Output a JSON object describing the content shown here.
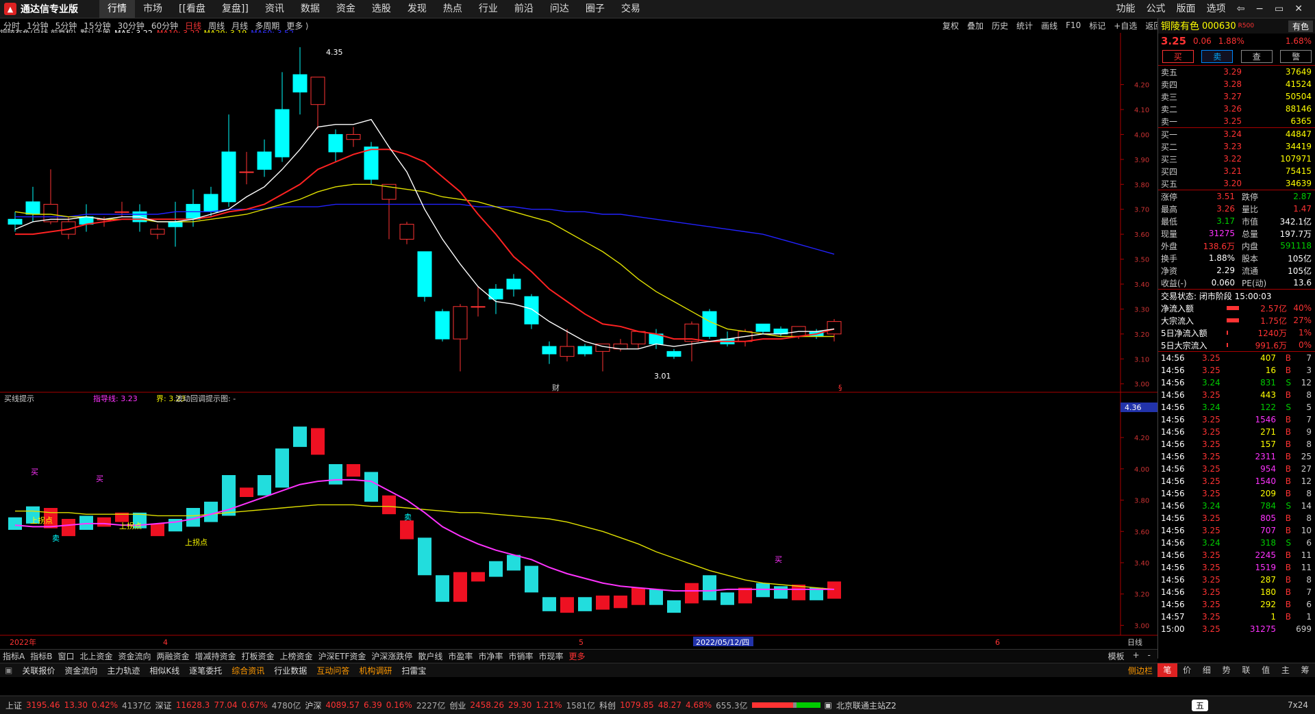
{
  "app": {
    "title": "通达信专业版",
    "menu": [
      "行情",
      "市场",
      "[[看盘",
      "复盘]]",
      "资讯",
      "数据",
      "资金",
      "选股",
      "发现",
      "热点",
      "行业",
      "前沿",
      "问达",
      "圈子",
      "交易"
    ],
    "right_menu": [
      "功能",
      "公式",
      "版面",
      "选项"
    ]
  },
  "periods": [
    "分时",
    "1分钟",
    "5分钟",
    "15分钟",
    "30分钟",
    "60分钟",
    "日线",
    "周线",
    "月线",
    "多周期",
    "更多 ⟩"
  ],
  "toolbar2": [
    "复权",
    "叠加",
    "历史",
    "统计",
    "画线",
    "F10",
    "标记",
    "+自选",
    "返回"
  ],
  "main_header": {
    "stock": "铜陵有色(日线,前复权)",
    "template": "默认主图",
    "ma5": "MA5: 3.22",
    "ma10": "MA10: 3.22",
    "ma20": "MA20: 3.19",
    "ma60": "MA60: 3.52"
  },
  "sub_header": {
    "name": "买线提示",
    "guide": "指导线: 3.23",
    "jie": "界: 3.23",
    "wave": "波动回调提示图: -"
  },
  "annotations": {
    "high": "4.35",
    "low": "3.01",
    "cai": "财",
    "s1": "§",
    "buy1": "买",
    "buy2": "买",
    "buy3": "买",
    "sell1": "卖",
    "sell2": "卖",
    "up1": "上拐点",
    "up2": "上拐点",
    "up3": "上拐点"
  },
  "axis_main": [
    "4.20",
    "4.10",
    "4.00",
    "3.90",
    "3.80",
    "3.70",
    "3.60",
    "3.50",
    "3.40",
    "3.30",
    "3.20",
    "3.10",
    "3.00"
  ],
  "axis_sub": [
    "4.20",
    "4.00",
    "3.80",
    "3.60",
    "3.40",
    "3.20",
    "3.00"
  ],
  "axis_sub_top": "4.36",
  "date_axis": {
    "start": "2022年",
    "m4": "4",
    "m5": "5",
    "cursor": "2022/05/12/四",
    "m6": "6",
    "period": "日线"
  },
  "chart_data": {
    "type": "candlestick",
    "title": "铜陵有色(日线,前复权)",
    "ylim": [
      2.98,
      4.38
    ],
    "candles": [
      [
        3.66,
        3.64,
        3.69,
        3.61
      ],
      [
        3.73,
        3.68,
        3.79,
        3.65
      ],
      [
        3.65,
        3.72,
        3.86,
        3.64
      ],
      [
        3.6,
        3.65,
        3.67,
        3.58
      ],
      [
        3.67,
        3.64,
        3.72,
        3.61
      ],
      [
        3.66,
        3.66,
        3.67,
        3.63
      ],
      [
        3.69,
        3.69,
        3.73,
        3.67
      ],
      [
        3.69,
        3.65,
        3.72,
        3.61
      ],
      [
        3.6,
        3.62,
        3.64,
        3.58
      ],
      [
        3.65,
        3.63,
        3.73,
        3.55
      ],
      [
        3.72,
        3.66,
        3.78,
        3.63
      ],
      [
        3.76,
        3.69,
        3.79,
        3.67
      ],
      [
        3.93,
        3.73,
        4.08,
        3.71
      ],
      [
        3.85,
        3.85,
        3.93,
        3.8
      ],
      [
        3.93,
        3.86,
        3.98,
        3.83
      ],
      [
        4.1,
        3.91,
        4.25,
        3.89
      ],
      [
        4.24,
        4.17,
        4.35,
        4.08
      ],
      [
        4.12,
        4.23,
        4.2,
        4.02
      ],
      [
        4.0,
        3.93,
        4.02,
        3.89
      ],
      [
        3.98,
        4.0,
        4.03,
        3.95
      ],
      [
        3.95,
        3.82,
        3.97,
        3.8
      ],
      [
        3.74,
        3.8,
        3.75,
        3.58
      ],
      [
        3.58,
        3.64,
        3.65,
        3.56
      ],
      [
        3.53,
        3.35,
        3.53,
        3.33
      ],
      [
        3.29,
        3.18,
        3.3,
        3.17
      ],
      [
        3.18,
        3.31,
        3.32,
        3.05
      ],
      [
        3.31,
        3.31,
        3.39,
        3.27
      ],
      [
        3.38,
        3.34,
        3.4,
        3.28
      ],
      [
        3.42,
        3.38,
        3.44,
        3.35
      ],
      [
        3.35,
        3.24,
        3.36,
        3.22
      ],
      [
        3.15,
        3.12,
        3.17,
        3.08
      ],
      [
        3.11,
        3.15,
        3.22,
        3.09
      ],
      [
        3.15,
        3.12,
        3.16,
        3.11
      ],
      [
        3.13,
        3.16,
        3.16,
        3.05
      ],
      [
        3.14,
        3.16,
        3.18,
        3.13
      ],
      [
        3.16,
        3.21,
        3.21,
        3.14
      ],
      [
        3.2,
        3.16,
        3.22,
        3.14
      ],
      [
        3.13,
        3.11,
        3.14,
        3.1
      ],
      [
        3.17,
        3.24,
        3.25,
        3.09
      ],
      [
        3.29,
        3.19,
        3.3,
        3.18
      ],
      [
        3.18,
        3.16,
        3.21,
        3.15
      ],
      [
        3.17,
        3.21,
        3.22,
        3.15
      ],
      [
        3.24,
        3.21,
        3.24,
        3.2
      ],
      [
        3.22,
        3.2,
        3.23,
        3.19
      ],
      [
        3.19,
        3.23,
        3.23,
        3.18
      ],
      [
        3.21,
        3.19,
        3.22,
        3.18
      ],
      [
        3.2,
        3.25,
        3.26,
        3.17
      ]
    ],
    "ma5": [
      3.62,
      3.65,
      3.66,
      3.66,
      3.67,
      3.66,
      3.67,
      3.67,
      3.65,
      3.65,
      3.66,
      3.68,
      3.7,
      3.75,
      3.79,
      3.86,
      3.94,
      4.03,
      4.04,
      4.04,
      4.06,
      3.95,
      3.85,
      3.7,
      3.58,
      3.48,
      3.39,
      3.33,
      3.32,
      3.3,
      3.25,
      3.21,
      3.17,
      3.15,
      3.14,
      3.14,
      3.16,
      3.15,
      3.16,
      3.17,
      3.18,
      3.19,
      3.2,
      3.2,
      3.21,
      3.21,
      3.22
    ],
    "ma10": [
      3.6,
      3.6,
      3.61,
      3.62,
      3.64,
      3.65,
      3.66,
      3.66,
      3.66,
      3.66,
      3.66,
      3.67,
      3.69,
      3.7,
      3.72,
      3.76,
      3.8,
      3.86,
      3.89,
      3.92,
      3.94,
      3.94,
      3.92,
      3.89,
      3.83,
      3.77,
      3.68,
      3.6,
      3.51,
      3.45,
      3.38,
      3.33,
      3.28,
      3.24,
      3.23,
      3.21,
      3.2,
      3.18,
      3.18,
      3.17,
      3.17,
      3.17,
      3.18,
      3.18,
      3.19,
      3.2,
      3.22
    ],
    "ma20": [
      3.69,
      3.68,
      3.68,
      3.67,
      3.67,
      3.66,
      3.66,
      3.66,
      3.65,
      3.65,
      3.65,
      3.66,
      3.67,
      3.68,
      3.7,
      3.72,
      3.74,
      3.77,
      3.79,
      3.8,
      3.8,
      3.79,
      3.78,
      3.77,
      3.75,
      3.74,
      3.73,
      3.71,
      3.69,
      3.67,
      3.65,
      3.61,
      3.57,
      3.53,
      3.48,
      3.42,
      3.37,
      3.33,
      3.29,
      3.25,
      3.22,
      3.21,
      3.2,
      3.19,
      3.19,
      3.19,
      3.19
    ],
    "ma60": [
      3.67,
      3.67,
      3.67,
      3.67,
      3.68,
      3.68,
      3.68,
      3.68,
      3.68,
      3.69,
      3.69,
      3.69,
      3.7,
      3.7,
      3.7,
      3.71,
      3.71,
      3.71,
      3.72,
      3.72,
      3.72,
      3.72,
      3.72,
      3.72,
      3.72,
      3.72,
      3.71,
      3.71,
      3.71,
      3.7,
      3.7,
      3.69,
      3.69,
      3.68,
      3.68,
      3.67,
      3.66,
      3.65,
      3.64,
      3.63,
      3.62,
      3.61,
      3.6,
      3.58,
      3.56,
      3.54,
      3.52
    ],
    "guide_line": [
      3.64,
      3.63,
      3.63,
      3.64,
      3.65,
      3.65,
      3.64,
      3.64,
      3.65,
      3.66,
      3.68,
      3.71,
      3.74,
      3.78,
      3.82,
      3.86,
      3.9,
      3.92,
      3.93,
      3.93,
      3.92,
      3.86,
      3.8,
      3.72,
      3.63,
      3.57,
      3.52,
      3.48,
      3.45,
      3.42,
      3.37,
      3.33,
      3.3,
      3.27,
      3.25,
      3.24,
      3.23,
      3.22,
      3.22,
      3.22,
      3.23,
      3.23,
      3.23,
      3.23,
      3.23,
      3.23,
      3.23
    ],
    "jie_line": [
      3.73,
      3.73,
      3.72,
      3.72,
      3.71,
      3.71,
      3.71,
      3.71,
      3.7,
      3.7,
      3.7,
      3.71,
      3.72,
      3.73,
      3.74,
      3.75,
      3.76,
      3.77,
      3.77,
      3.77,
      3.76,
      3.76,
      3.75,
      3.74,
      3.73,
      3.72,
      3.72,
      3.71,
      3.7,
      3.69,
      3.68,
      3.66,
      3.63,
      3.6,
      3.56,
      3.52,
      3.47,
      3.43,
      3.39,
      3.35,
      3.32,
      3.29,
      3.27,
      3.26,
      3.25,
      3.24,
      3.23
    ]
  },
  "quote": {
    "name": "铜陵有色",
    "code": "000630",
    "tag": "R500",
    "sector": "有色",
    "price": "3.25",
    "change": "0.06",
    "pct": "1.88%",
    "pct2": "1.68%",
    "btn_buy": "买",
    "btn_sell": "卖",
    "btn_query": "查",
    "btn_alert": "警",
    "asks": [
      [
        "卖五",
        "3.29",
        "37649"
      ],
      [
        "卖四",
        "3.28",
        "41524"
      ],
      [
        "卖三",
        "3.27",
        "50504"
      ],
      [
        "卖二",
        "3.26",
        "88146"
      ],
      [
        "卖一",
        "3.25",
        "6365"
      ]
    ],
    "bids": [
      [
        "买一",
        "3.24",
        "44847"
      ],
      [
        "买二",
        "3.23",
        "34419"
      ],
      [
        "买三",
        "3.22",
        "107971"
      ],
      [
        "买四",
        "3.21",
        "75415"
      ],
      [
        "买五",
        "3.20",
        "34639"
      ]
    ],
    "stats": [
      [
        "涨停",
        "3.51",
        "跌停",
        "2.87"
      ],
      [
        "最高",
        "3.26",
        "量比",
        "1.47"
      ],
      [
        "最低",
        "3.17",
        "市值",
        "342.1亿"
      ],
      [
        "现量",
        "31275",
        "总量",
        "197.7万"
      ],
      [
        "外盘",
        "138.6万",
        "内盘",
        "591118"
      ],
      [
        "换手",
        "1.88%",
        "股本",
        "105亿"
      ],
      [
        "净资",
        "2.29",
        "流通",
        "105亿"
      ],
      [
        "收益(-)",
        "0.060",
        "PE(动)",
        "13.6"
      ]
    ],
    "trade_status": "交易状态: 闭市阶段 15:00:03",
    "flows": [
      [
        "净流入额",
        "2.57亿",
        "40%"
      ],
      [
        "大宗流入",
        "1.75亿",
        "27%"
      ],
      [
        "5日净流入额",
        "1240万",
        "1%"
      ],
      [
        "5日大宗流入",
        "991.6万",
        "0%"
      ]
    ],
    "ticks": [
      [
        "14:56",
        "3.25",
        "407",
        "B",
        "7"
      ],
      [
        "14:56",
        "3.25",
        "16",
        "B",
        "3"
      ],
      [
        "14:56",
        "3.24",
        "831",
        "S",
        "12"
      ],
      [
        "14:56",
        "3.25",
        "443",
        "B",
        "8"
      ],
      [
        "14:56",
        "3.24",
        "122",
        "S",
        "5"
      ],
      [
        "14:56",
        "3.25",
        "1546",
        "B",
        "7"
      ],
      [
        "14:56",
        "3.25",
        "271",
        "B",
        "9"
      ],
      [
        "14:56",
        "3.25",
        "157",
        "B",
        "8"
      ],
      [
        "14:56",
        "3.25",
        "2311",
        "B",
        "25"
      ],
      [
        "14:56",
        "3.25",
        "954",
        "B",
        "27"
      ],
      [
        "14:56",
        "3.25",
        "1540",
        "B",
        "12"
      ],
      [
        "14:56",
        "3.25",
        "209",
        "B",
        "8"
      ],
      [
        "14:56",
        "3.24",
        "784",
        "S",
        "14"
      ],
      [
        "14:56",
        "3.25",
        "805",
        "B",
        "8"
      ],
      [
        "14:56",
        "3.25",
        "707",
        "B",
        "10"
      ],
      [
        "14:56",
        "3.24",
        "318",
        "S",
        "6"
      ],
      [
        "14:56",
        "3.25",
        "2245",
        "B",
        "11"
      ],
      [
        "14:56",
        "3.25",
        "1519",
        "B",
        "11"
      ],
      [
        "14:56",
        "3.25",
        "287",
        "B",
        "8"
      ],
      [
        "14:56",
        "3.25",
        "180",
        "B",
        "7"
      ],
      [
        "14:56",
        "3.25",
        "292",
        "B",
        "6"
      ],
      [
        "14:57",
        "3.25",
        "1",
        "B",
        "1"
      ],
      [
        "15:00",
        "3.25",
        "31275",
        "",
        "699"
      ]
    ],
    "tabs": [
      "笔",
      "价",
      "细",
      "势",
      "联",
      "值",
      "主",
      "筹"
    ]
  },
  "indicator_tabs": [
    "指标A",
    "指标B",
    "窗口",
    "北上资金",
    "资金流向",
    "两融资金",
    "增减持资金",
    "打板资金",
    "上榜资金",
    "沪深ETF资金",
    "沪深涨跌停",
    "散户线",
    "市盈率",
    "市净率",
    "市销率",
    "市现率",
    "更多"
  ],
  "indicator_right": [
    "模板",
    "+",
    "-"
  ],
  "func_tabs": [
    "关联报价",
    "资金流向",
    "主力轨迹",
    "相似K线",
    "逐笔委托",
    "综合资讯",
    "行业数据",
    "互动问答",
    "机构调研",
    "扫雷宝"
  ],
  "func_right": "侧边栏",
  "status": {
    "sh": "上证",
    "sh_v": "3195.46",
    "sh_c": "13.30",
    "sh_p": "0.42%",
    "sh_a": "4137亿",
    "sz": "深证",
    "sz_v": "11628.3",
    "sz_c": "77.04",
    "sz_p": "0.67%",
    "sz_a": "4780亿",
    "hs": "沪深",
    "hs_v": "4089.57",
    "hs_c": "6.39",
    "hs_p": "0.16%",
    "hs_a": "2227亿",
    "cy": "创业",
    "cy_v": "2458.26",
    "cy_c": "29.30",
    "cy_p": "1.21%",
    "cy_a": "1581亿",
    "kc": "科创",
    "kc_v": "1079.85",
    "kc_c": "48.27",
    "kc_p": "4.68%",
    "kc_a": "655.3亿",
    "server": "北京联通主站Z2",
    "ime": "五",
    "clock": "7x24"
  },
  "colors": {
    "up": "#ff3333",
    "down": "#00ffff",
    "ma5": "#ffffff",
    "ma10": "#ff2222",
    "ma20": "#e0e000",
    "ma60": "#2222ff",
    "guide": "#ff33ff",
    "jie": "#e0e000"
  }
}
